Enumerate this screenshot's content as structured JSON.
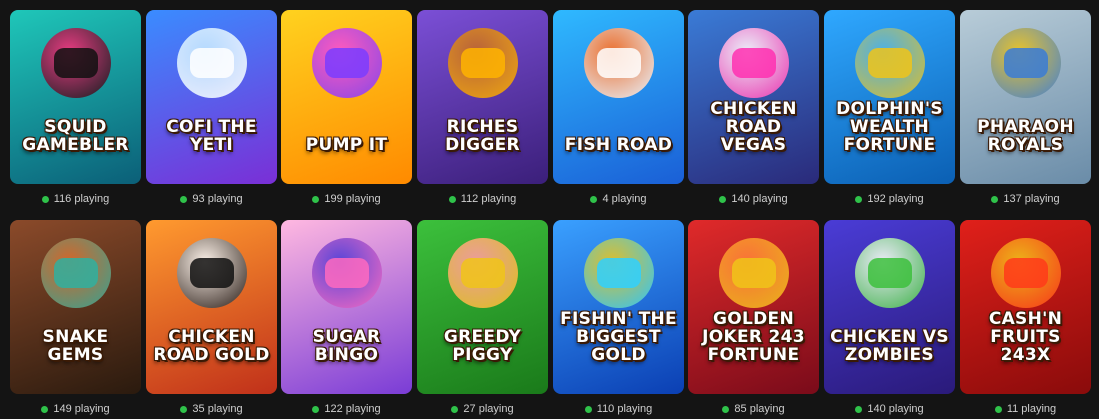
{
  "games": [
    {
      "title": "SQUID GAMEBLER",
      "players": "116 playing",
      "bg": [
        "#1fc7b9",
        "#0b5f78"
      ],
      "accent": "#ff2f7d",
      "accent2": "#111111"
    },
    {
      "title": "Cofi the yeti",
      "players": "93 playing",
      "bg": [
        "#3a8cff",
        "#7a2fd6"
      ],
      "accent": "#bfe4ff",
      "accent2": "#ffffff"
    },
    {
      "title": "PUMP IT",
      "players": "199 playing",
      "bg": [
        "#ffd21f",
        "#ff8a00"
      ],
      "accent": "#ff4fd0",
      "accent2": "#7a3cff"
    },
    {
      "title": "RICHES DIGGER",
      "players": "112 playing",
      "bg": [
        "#7b4fd6",
        "#3b1f7a"
      ],
      "accent": "#c0652c",
      "accent2": "#ffb400"
    },
    {
      "title": "FISH ROAD",
      "players": "4 playing",
      "bg": [
        "#2fb9ff",
        "#1a5fd6"
      ],
      "accent": "#ff6a1a",
      "accent2": "#ffffff"
    },
    {
      "title": "CHICKEN ROAD Vegas",
      "players": "140 playing",
      "bg": [
        "#3a7bd6",
        "#2a2a7a"
      ],
      "accent": "#ffffff",
      "accent2": "#ff2fb0"
    },
    {
      "title": "DOLPHIN'S WEALTH FORTUNE",
      "players": "192 playing",
      "bg": [
        "#2fa8ff",
        "#0b5fb3"
      ],
      "accent": "#4fb3e8",
      "accent2": "#f0c419"
    },
    {
      "title": "PHARAOH ROYALS",
      "players": "137 playing",
      "bg": [
        "#b8ccd8",
        "#6a8ca8"
      ],
      "accent": "#f0c419",
      "accent2": "#3a7bd6"
    },
    {
      "title": "Snake Gems",
      "players": "149 playing",
      "bg": [
        "#8b4a2a",
        "#2a1a0e"
      ],
      "accent": "#e06a2a",
      "accent2": "#2fb0a0"
    },
    {
      "title": "CHICKEN ROAD Gold",
      "players": "35 playing",
      "bg": [
        "#ff9a2f",
        "#c0301a"
      ],
      "accent": "#ffffff",
      "accent2": "#111111"
    },
    {
      "title": "SUGAR BINGO",
      "players": "122 playing",
      "bg": [
        "#ffb8e0",
        "#7a3cd6"
      ],
      "accent": "#4a3cd6",
      "accent2": "#ff6ac0"
    },
    {
      "title": "GREEDY PIGGY",
      "players": "27 playing",
      "bg": [
        "#3cc03c",
        "#1a7a1a"
      ],
      "accent": "#ff9aa8",
      "accent2": "#f0c419"
    },
    {
      "title": "FISHIN' the BIGGEST GOLD",
      "players": "110 playing",
      "bg": [
        "#3aa0ff",
        "#0b3fb3"
      ],
      "accent": "#f0c419",
      "accent2": "#2fd0ff"
    },
    {
      "title": "GOLDEN JOKER 243 FORTUNE",
      "players": "85 playing",
      "bg": [
        "#e02a2a",
        "#7a0b1a"
      ],
      "accent": "#ff7a3a",
      "accent2": "#f0c419"
    },
    {
      "title": "CHICKEN VS ZOMBIES",
      "players": "140 playing",
      "bg": [
        "#4a3cd6",
        "#2a1a7a"
      ],
      "accent": "#ffffff",
      "accent2": "#3cc03c"
    },
    {
      "title": "CASH'N FRUITS 243X",
      "players": "11 playing",
      "bg": [
        "#e0201a",
        "#8a0b0b"
      ],
      "accent": "#f0c419",
      "accent2": "#ff3a1a"
    }
  ]
}
